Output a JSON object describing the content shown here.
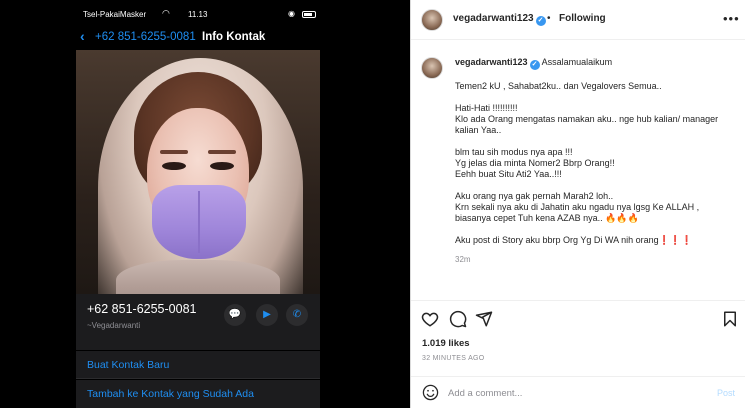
{
  "phone": {
    "carrier": "Tsel-PakaiMasker",
    "time": "11.13",
    "back_number": "+62 851-6255-0081",
    "nav_title": "Info Kontak",
    "contact_number": "+62 851-6255-0081",
    "contact_name": "~Vegadarwanti",
    "actions": [
      "Buat Kontak Baru",
      "Tambah ke Kontak yang Sudah Ada"
    ]
  },
  "header": {
    "username": "vegadarwanti123",
    "separator": "•",
    "follow_label": "Following",
    "more": "•••"
  },
  "post": {
    "username": "vegadarwanti123",
    "first_line": "Assalamualaikum",
    "paragraphs": [
      "Temen2 kU , Sahabat2ku.. dan Vegalovers Semua..",
      "Hati-Hati !!!!!!!!!!\nKlo ada Orang mengatas namakan aku.. nge hub kalian/ manager kalian Yaa..",
      "blm tau sih modus nya apa !!!\nYg jelas dia minta Nomer2 Bbrp Orang!!\nEehh buat Situ Ati2 Yaa..!!!",
      "Aku orang nya gak pernah Marah2 loh..\nKrn sekali nya aku di Jahatin aku ngadu nya lgsg Ke ALLAH ,\nbiasanya cepet Tuh kena AZAB nya.. 🔥🔥🔥",
      "Aku post di Story aku bbrp Org Yg Di WA nih orang❗❗❗"
    ],
    "time": "32m"
  },
  "stats": {
    "likes": "1.019 likes",
    "ago": "32 MINUTES AGO"
  },
  "comment_box": {
    "placeholder": "Add a comment...",
    "post_label": "Post"
  },
  "colors": {
    "ios_blue": "#1f8ef1",
    "verified": "#3897f0",
    "mask_purple": "#a58ddf"
  }
}
